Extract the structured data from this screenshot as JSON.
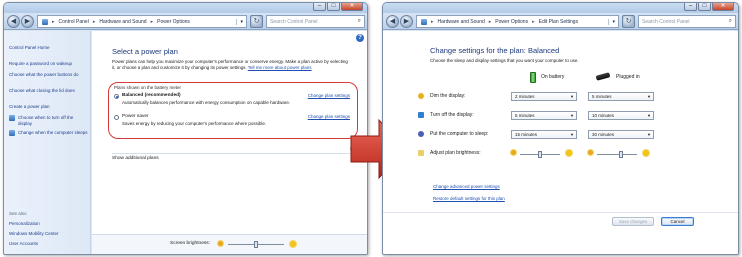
{
  "left_window": {
    "breadcrumbs": [
      "Control Panel",
      "Hardware and Sound",
      "Power Options"
    ],
    "search_placeholder": "Search Control Panel",
    "sidebar": {
      "home": "Control Panel Home",
      "links": [
        "Require a password on wakeup",
        "Choose what the power buttons do",
        "Choose what closing the lid does",
        "Create a power plan",
        "Choose when to turn off the display",
        "Change when the computer sleeps"
      ],
      "see_also_label": "See also",
      "see_also": [
        "Personalization",
        "Windows Mobility Center",
        "User Accounts"
      ]
    },
    "title": "Select a power plan",
    "intro": "Power plans can help you maximize your computer's performance or conserve energy. Make a plan active by selecting it, or choose a plan and customize it by changing its power settings.",
    "intro_link": "Tell me more about power plans",
    "plans_header": "Plans shown on the battery meter",
    "plans": [
      {
        "name": "Balanced (recommended)",
        "desc": "Automatically balances performance with energy consumption on capable hardware.",
        "link": "Change plan settings",
        "selected": true
      },
      {
        "name": "Power saver",
        "desc": "Saves energy by reducing your computer's performance where possible.",
        "link": "Change plan settings",
        "selected": false
      }
    ],
    "additional_plans": "Show additional plans",
    "screen_brightness": "Screen brightness:"
  },
  "right_window": {
    "breadcrumbs": [
      "Hardware and Sound",
      "Power Options",
      "Edit Plan Settings"
    ],
    "search_placeholder": "Search Control Panel",
    "title": "Change settings for the plan: Balanced",
    "subtitle": "Choose the sleep and display settings that you want your computer to use.",
    "col_battery": "On battery",
    "col_plugged": "Plugged in",
    "settings": [
      {
        "label": "Dim the display:",
        "battery": "2 minutes",
        "plugged": "5 minutes"
      },
      {
        "label": "Turn off the display:",
        "battery": "5 minutes",
        "plugged": "10 minutes"
      },
      {
        "label": "Put the computer to sleep:",
        "battery": "15 minutes",
        "plugged": "30 minutes"
      }
    ],
    "brightness_label": "Adjust plan brightness:",
    "advanced_link": "Change advanced power settings",
    "restore_link": "Restore default settings for this plan",
    "save_button": "Save changes",
    "cancel_button": "Cancel"
  },
  "colors": {
    "accent": "#1e3a7a",
    "link": "#1e4fb0",
    "highlight": "#d43a3a",
    "arrow": "#d13b2e"
  }
}
